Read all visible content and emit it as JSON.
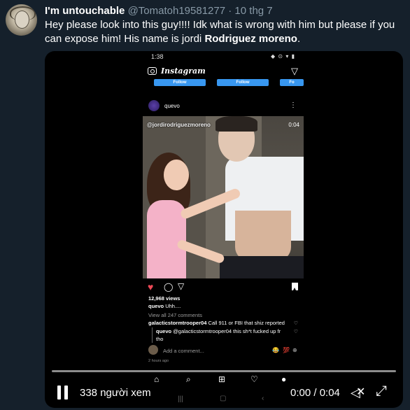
{
  "tweet": {
    "display_name": "I'm untouchable",
    "handle": "@Tomatoh19581277",
    "separator": "·",
    "date": "10 thg 7",
    "text_part1": "Hey please look into this guy!!!! Idk what is wrong with him but please if you can expose him! His name is jordi ",
    "text_bold": "Rodriguez moreno",
    "text_end": "."
  },
  "phone": {
    "status_time": "1:38",
    "status_icons": "◆ ⊙ ▾ ▮",
    "app_title": "Instagram",
    "follow_label": "Follow",
    "follow_partial": "Fo",
    "post_user": "quevo",
    "more_icon": "⋮",
    "video_watermark": "@jordirodriguezmoreno",
    "video_time": "0:04",
    "views": "12,968 views",
    "caption_user": "quevo",
    "caption_text": "Uhh....",
    "view_all": "View all 247 comments",
    "comment1_user": "galacticstormtrooper04",
    "comment1_text": "Call 911 or FBI that shiz reported",
    "comment2_user": "quevo",
    "comment2_text": "@galacticstormtrooper04 this sh*t fucked up fr",
    "comment2_cont": "tho",
    "add_comment": "Add a comment...",
    "time_ago": "2 hours ago",
    "emoji1": "😂",
    "emoji2": "💯",
    "emoji3": "⊕"
  },
  "player": {
    "viewers": "338 người xem",
    "timecode": "0:00 / 0:04",
    "progress": 0
  },
  "icons": {
    "heart": "heart-icon",
    "comment": "comment-icon",
    "share": "send-icon",
    "bookmark": "bookmark-icon",
    "pause": "pause-icon",
    "mute": "mute-icon",
    "fullscreen": "fullscreen-icon"
  },
  "colors": {
    "background": "#15202b",
    "meta_text": "#8899a6",
    "like_red": "#ed4956",
    "follow_blue": "#3897f0"
  }
}
